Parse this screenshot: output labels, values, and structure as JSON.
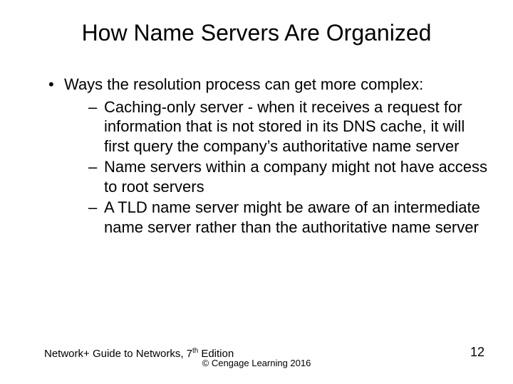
{
  "title": "How Name Servers Are Organized",
  "bullets": {
    "p0": "Ways the resolution process can get more complex:",
    "s0": "Caching-only server - when it receives a request for information that is not stored in its DNS cache, it will first query the company’s authoritative name server",
    "s1": "Name servers within a company might not have access to root servers",
    "s2": "A TLD name server might be aware of an intermediate name server rather than the authoritative name server"
  },
  "footer": {
    "left_a": "Network+ Guide to Networks, 7",
    "left_b": "th",
    "left_c": " Edition",
    "center": "© Cengage Learning  2016",
    "right": "12"
  }
}
